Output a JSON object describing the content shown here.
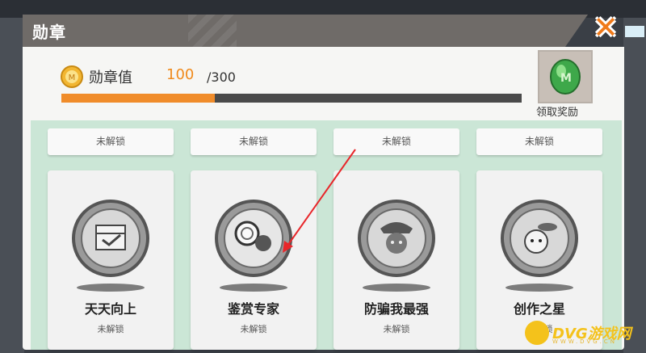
{
  "window": {
    "title": "勋章"
  },
  "score": {
    "label": "勋章值",
    "value": "100",
    "max": "/300",
    "progress": 0.333
  },
  "reward": {
    "label": "领取奖励"
  },
  "top_cards": [
    {
      "status": "未解锁"
    },
    {
      "status": "未解锁"
    },
    {
      "status": "未解锁"
    },
    {
      "status": "未解锁"
    }
  ],
  "badges": [
    {
      "name": "天天向上",
      "status": "未解锁"
    },
    {
      "name": "鉴赏专家",
      "status": "未解锁"
    },
    {
      "name": "防骗我最强",
      "status": "未解锁"
    },
    {
      "name": "创作之星",
      "status": "未解锁"
    }
  ],
  "watermark": {
    "text": "DVG游戏网",
    "sub": "WWW.DVG.CN"
  },
  "colors": {
    "accent": "#f08c2a",
    "panel": "#f6f6f4",
    "grid_bg": "#cbe6d6"
  }
}
